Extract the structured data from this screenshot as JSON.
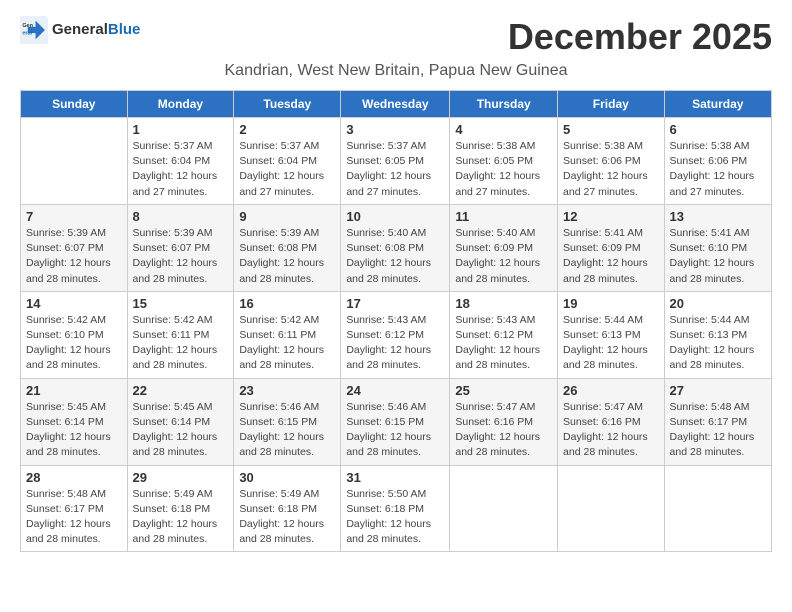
{
  "header": {
    "logo_general": "General",
    "logo_blue": "Blue",
    "month_title": "December 2025",
    "location": "Kandrian, West New Britain, Papua New Guinea"
  },
  "days_of_week": [
    "Sunday",
    "Monday",
    "Tuesday",
    "Wednesday",
    "Thursday",
    "Friday",
    "Saturday"
  ],
  "weeks": [
    [
      {
        "day": "",
        "detail": ""
      },
      {
        "day": "1",
        "detail": "Sunrise: 5:37 AM\nSunset: 6:04 PM\nDaylight: 12 hours\nand 27 minutes."
      },
      {
        "day": "2",
        "detail": "Sunrise: 5:37 AM\nSunset: 6:04 PM\nDaylight: 12 hours\nand 27 minutes."
      },
      {
        "day": "3",
        "detail": "Sunrise: 5:37 AM\nSunset: 6:05 PM\nDaylight: 12 hours\nand 27 minutes."
      },
      {
        "day": "4",
        "detail": "Sunrise: 5:38 AM\nSunset: 6:05 PM\nDaylight: 12 hours\nand 27 minutes."
      },
      {
        "day": "5",
        "detail": "Sunrise: 5:38 AM\nSunset: 6:06 PM\nDaylight: 12 hours\nand 27 minutes."
      },
      {
        "day": "6",
        "detail": "Sunrise: 5:38 AM\nSunset: 6:06 PM\nDaylight: 12 hours\nand 27 minutes."
      }
    ],
    [
      {
        "day": "7",
        "detail": "Sunrise: 5:39 AM\nSunset: 6:07 PM\nDaylight: 12 hours\nand 28 minutes."
      },
      {
        "day": "8",
        "detail": "Sunrise: 5:39 AM\nSunset: 6:07 PM\nDaylight: 12 hours\nand 28 minutes."
      },
      {
        "day": "9",
        "detail": "Sunrise: 5:39 AM\nSunset: 6:08 PM\nDaylight: 12 hours\nand 28 minutes."
      },
      {
        "day": "10",
        "detail": "Sunrise: 5:40 AM\nSunset: 6:08 PM\nDaylight: 12 hours\nand 28 minutes."
      },
      {
        "day": "11",
        "detail": "Sunrise: 5:40 AM\nSunset: 6:09 PM\nDaylight: 12 hours\nand 28 minutes."
      },
      {
        "day": "12",
        "detail": "Sunrise: 5:41 AM\nSunset: 6:09 PM\nDaylight: 12 hours\nand 28 minutes."
      },
      {
        "day": "13",
        "detail": "Sunrise: 5:41 AM\nSunset: 6:10 PM\nDaylight: 12 hours\nand 28 minutes."
      }
    ],
    [
      {
        "day": "14",
        "detail": "Sunrise: 5:42 AM\nSunset: 6:10 PM\nDaylight: 12 hours\nand 28 minutes."
      },
      {
        "day": "15",
        "detail": "Sunrise: 5:42 AM\nSunset: 6:11 PM\nDaylight: 12 hours\nand 28 minutes."
      },
      {
        "day": "16",
        "detail": "Sunrise: 5:42 AM\nSunset: 6:11 PM\nDaylight: 12 hours\nand 28 minutes."
      },
      {
        "day": "17",
        "detail": "Sunrise: 5:43 AM\nSunset: 6:12 PM\nDaylight: 12 hours\nand 28 minutes."
      },
      {
        "day": "18",
        "detail": "Sunrise: 5:43 AM\nSunset: 6:12 PM\nDaylight: 12 hours\nand 28 minutes."
      },
      {
        "day": "19",
        "detail": "Sunrise: 5:44 AM\nSunset: 6:13 PM\nDaylight: 12 hours\nand 28 minutes."
      },
      {
        "day": "20",
        "detail": "Sunrise: 5:44 AM\nSunset: 6:13 PM\nDaylight: 12 hours\nand 28 minutes."
      }
    ],
    [
      {
        "day": "21",
        "detail": "Sunrise: 5:45 AM\nSunset: 6:14 PM\nDaylight: 12 hours\nand 28 minutes."
      },
      {
        "day": "22",
        "detail": "Sunrise: 5:45 AM\nSunset: 6:14 PM\nDaylight: 12 hours\nand 28 minutes."
      },
      {
        "day": "23",
        "detail": "Sunrise: 5:46 AM\nSunset: 6:15 PM\nDaylight: 12 hours\nand 28 minutes."
      },
      {
        "day": "24",
        "detail": "Sunrise: 5:46 AM\nSunset: 6:15 PM\nDaylight: 12 hours\nand 28 minutes."
      },
      {
        "day": "25",
        "detail": "Sunrise: 5:47 AM\nSunset: 6:16 PM\nDaylight: 12 hours\nand 28 minutes."
      },
      {
        "day": "26",
        "detail": "Sunrise: 5:47 AM\nSunset: 6:16 PM\nDaylight: 12 hours\nand 28 minutes."
      },
      {
        "day": "27",
        "detail": "Sunrise: 5:48 AM\nSunset: 6:17 PM\nDaylight: 12 hours\nand 28 minutes."
      }
    ],
    [
      {
        "day": "28",
        "detail": "Sunrise: 5:48 AM\nSunset: 6:17 PM\nDaylight: 12 hours\nand 28 minutes."
      },
      {
        "day": "29",
        "detail": "Sunrise: 5:49 AM\nSunset: 6:18 PM\nDaylight: 12 hours\nand 28 minutes."
      },
      {
        "day": "30",
        "detail": "Sunrise: 5:49 AM\nSunset: 6:18 PM\nDaylight: 12 hours\nand 28 minutes."
      },
      {
        "day": "31",
        "detail": "Sunrise: 5:50 AM\nSunset: 6:18 PM\nDaylight: 12 hours\nand 28 minutes."
      },
      {
        "day": "",
        "detail": ""
      },
      {
        "day": "",
        "detail": ""
      },
      {
        "day": "",
        "detail": ""
      }
    ]
  ]
}
